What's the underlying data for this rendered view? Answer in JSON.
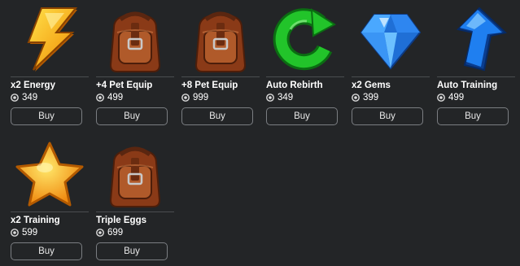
{
  "items": [
    {
      "name": "x2 Energy",
      "price": "349",
      "buy_label": "Buy",
      "icon": "lightning-icon"
    },
    {
      "name": "+4 Pet Equip",
      "price": "499",
      "buy_label": "Buy",
      "icon": "backpack-icon"
    },
    {
      "name": "+8 Pet Equip",
      "price": "999",
      "buy_label": "Buy",
      "icon": "backpack-icon"
    },
    {
      "name": "Auto Rebirth",
      "price": "349",
      "buy_label": "Buy",
      "icon": "rebirth-arrow-icon"
    },
    {
      "name": "x2 Gems",
      "price": "399",
      "buy_label": "Buy",
      "icon": "gem-icon"
    },
    {
      "name": "Auto Training",
      "price": "499",
      "buy_label": "Buy",
      "icon": "up-arrow-icon"
    },
    {
      "name": "x2 Training",
      "price": "599",
      "buy_label": "Buy",
      "icon": "star-icon"
    },
    {
      "name": "Triple Eggs",
      "price": "699",
      "buy_label": "Buy",
      "icon": "backpack-icon"
    }
  ],
  "currency_icon": "robux-icon",
  "colors": {
    "background": "#232527",
    "button_border": "#7b7e82",
    "divider": "#4a4d50"
  }
}
